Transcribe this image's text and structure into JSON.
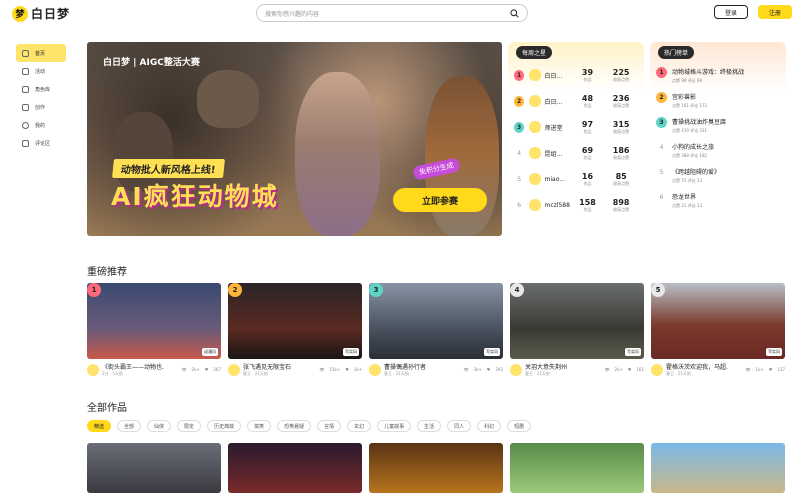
{
  "app": {
    "logo_text": "白日梦",
    "logo_glyph": "梦"
  },
  "header": {
    "search_placeholder": "搜索你感兴趣的内容",
    "login": "登录",
    "register": "注册"
  },
  "sidebar": {
    "items": [
      {
        "label": "首页",
        "icon": "home-icon",
        "active": true
      },
      {
        "label": "活动",
        "icon": "calendar-icon"
      },
      {
        "label": "角色库",
        "icon": "character-icon"
      },
      {
        "label": "创作",
        "icon": "create-icon"
      },
      {
        "label": "我的",
        "icon": "user-icon"
      },
      {
        "label": "评论区",
        "icon": "comment-icon"
      }
    ]
  },
  "banner": {
    "brand": "白日梦 | AIGC整活大赛",
    "subtitle": "动物批人新风格上线!",
    "title": "AI疯狂动物城",
    "tag": "免积分生成",
    "cta": "立即参赛"
  },
  "weekly_rank": {
    "title": "每周之星",
    "rows": [
      {
        "rank": "1",
        "name": "白日...",
        "works": "39",
        "works_label": "作品",
        "likes": "225",
        "likes_label": "收获点赞"
      },
      {
        "rank": "2",
        "name": "白日...",
        "works": "48",
        "works_label": "作品",
        "likes": "236",
        "likes_label": "收获点赞"
      },
      {
        "rank": "3",
        "name": "师进堂",
        "works": "97",
        "works_label": "作品",
        "likes": "315",
        "likes_label": "收获点赞"
      },
      {
        "rank": "4",
        "name": "昆组...",
        "works": "69",
        "works_label": "作品",
        "likes": "186",
        "likes_label": "收获点赞"
      },
      {
        "rank": "5",
        "name": "miao...",
        "works": "16",
        "works_label": "作品",
        "likes": "85",
        "likes_label": "收获点赞"
      },
      {
        "rank": "6",
        "name": "mczl588",
        "works": "158",
        "works_label": "作品",
        "likes": "898",
        "likes_label": "收获点赞"
      }
    ]
  },
  "hot_rank": {
    "title": "热门榜单",
    "rows": [
      {
        "rank": "1",
        "title": "动物城格斗游戏：终极挑战",
        "meta": "点赞 98   评论 98"
      },
      {
        "rank": "2",
        "title": "宫彩兽影",
        "meta": "点赞 161   评论 172"
      },
      {
        "rank": "3",
        "title": "曹操挑战油炸臭豆腐",
        "meta": "点赞 419   评论 231"
      },
      {
        "rank": "4",
        "title": "小狗的成长之旅",
        "meta": "点赞 388   评论 182"
      },
      {
        "rank": "5",
        "title": "《跨越阻碍的爱》",
        "meta": "点赞 75   评论 33"
      },
      {
        "rank": "6",
        "title": "恐龙世界",
        "meta": "点赞 21   评论 13"
      }
    ]
  },
  "featured": {
    "title": "重磅推荐",
    "cards": [
      {
        "rank": "1",
        "title": "《街头霸王——动物也...",
        "author": "2分",
        "time": "5天前",
        "views": "2k+",
        "likes": "267",
        "tag": "动漫风"
      },
      {
        "rank": "2",
        "title": "张飞遇见无限宝石",
        "author": "意王",
        "time": "21天前",
        "views": "15k+",
        "likes": "1k+",
        "tag": "写实风"
      },
      {
        "rank": "3",
        "title": "曹操偶遇孙行者",
        "author": "意王",
        "time": "21天前",
        "views": "3k+",
        "likes": "292",
        "tag": "写实风"
      },
      {
        "rank": "4",
        "title": "关羽大意失荆州",
        "author": "意王",
        "time": "21天前",
        "views": "2k+",
        "likes": "161",
        "tag": "写实风"
      },
      {
        "rank": "5",
        "title": "霍格沃茨欢迎我，马超...",
        "author": "意王",
        "time": "21天前",
        "views": "1k+",
        "likes": "137",
        "tag": "写实风"
      }
    ]
  },
  "all_works": {
    "title": "全部作品",
    "chips": [
      "精选",
      "全部",
      "仙侠",
      "限定",
      "历史典故",
      "搞笑",
      "恐怖悬疑",
      "言情",
      "玄幻",
      "儿童故事",
      "生活",
      "同人",
      "科幻",
      "短剧"
    ]
  }
}
